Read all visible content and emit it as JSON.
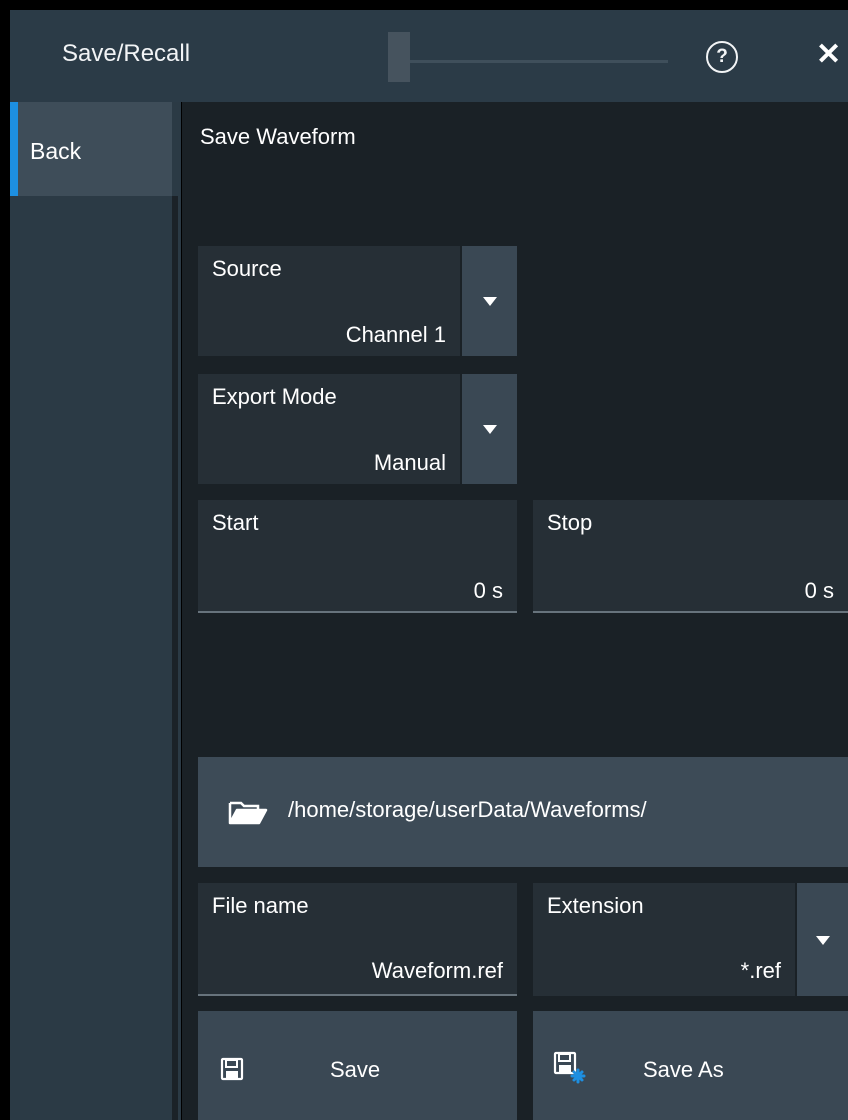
{
  "window": {
    "title": "Save/Recall",
    "help_glyph": "?",
    "close_glyph": "✕"
  },
  "sidebar": {
    "back_label": "Back"
  },
  "section": {
    "title": "Save Waveform"
  },
  "source": {
    "label": "Source",
    "value": "Channel 1"
  },
  "export_mode": {
    "label": "Export Mode",
    "value": "Manual"
  },
  "start": {
    "label": "Start",
    "value": "0 s"
  },
  "stop": {
    "label": "Stop",
    "value": "0 s"
  },
  "path": {
    "text": "/home/storage/userData/Waveforms/"
  },
  "file_name": {
    "label": "File name",
    "value": "Waveform.ref"
  },
  "extension": {
    "label": "Extension",
    "value": "*.ref"
  },
  "actions": {
    "save_label": "Save",
    "save_as_label": "Save As"
  },
  "colors": {
    "accent": "#1d8fe1",
    "panel": "#262f36",
    "button": "#3a4854",
    "background": "#1a2126"
  }
}
